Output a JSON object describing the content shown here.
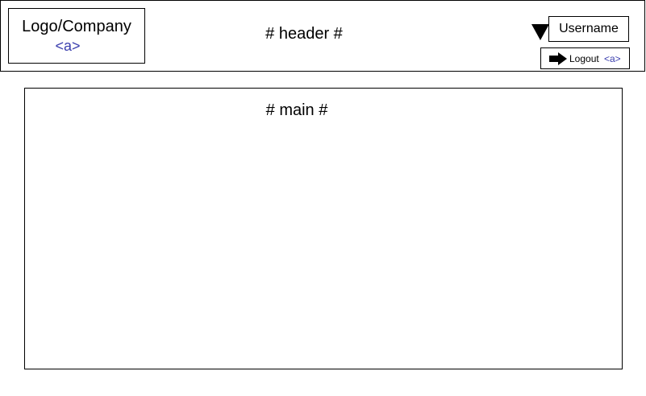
{
  "header": {
    "logo": {
      "text": "Logo/Company",
      "link": "<a>"
    },
    "title": "# header #",
    "user": {
      "username": "Username",
      "dropdown_icon": "triangle-down-icon"
    },
    "logout": {
      "icon": "arrow-right-icon",
      "label": "Logout",
      "link": "<a>"
    }
  },
  "main": {
    "title": "# main #"
  },
  "colors": {
    "border": "#000000",
    "link": "#3b3fae",
    "background": "#ffffff"
  }
}
